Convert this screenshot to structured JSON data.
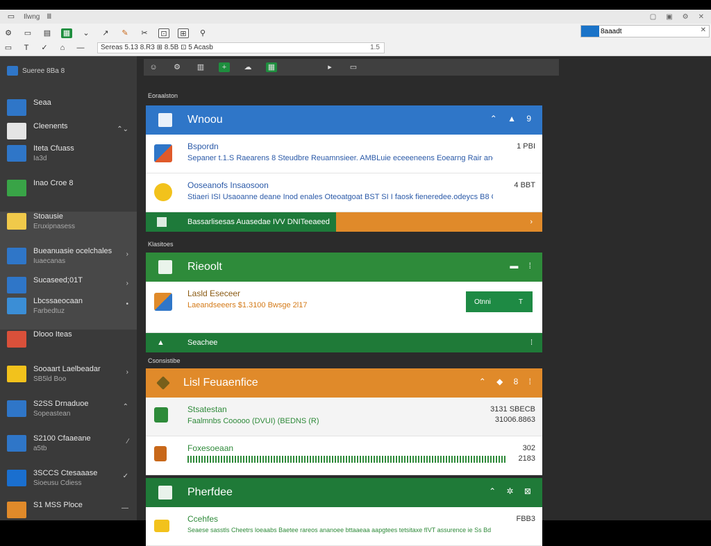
{
  "titlebar": {
    "app": "Ilwng",
    "tab": "Ⅲ"
  },
  "ribbon": {
    "address": "Sereas 5.13 8.R3 ⊞ 8.5B ⊡ 5 Acasb",
    "zoom": "1.5",
    "search_value": "8aaadt"
  },
  "sidebar": {
    "header": "Sueree 8Ba 8",
    "items": [
      {
        "t1": "Seaa",
        "t2": "",
        "chev": "",
        "color": "#2f76c8"
      },
      {
        "t1": "Cleenents",
        "t2": "",
        "chev": "⌃⌄",
        "color": "#e5e5e5"
      },
      {
        "t1": "Iteta Cfuass",
        "t2": "Ia3d",
        "chev": "",
        "color": "#2f76c8"
      },
      {
        "t1": "Inao Croe 8",
        "t2": "",
        "chev": "",
        "color": "#39a447"
      },
      {
        "t1": "Stoausie",
        "t2": "Eruxipnasess",
        "chev": "",
        "color": "#f0c94a"
      },
      {
        "t1": "Bueanuasie ocelchales",
        "t2": "Iuaecanas",
        "chev": "›",
        "color": "#2f76c8"
      },
      {
        "t1": "Sucaseed;01T",
        "t2": "",
        "chev": "›",
        "color": "#2f76c8"
      },
      {
        "t1": "Lbcssaeocaan",
        "t2": "Farbedtuz",
        "chev": "•",
        "color": "#3b8ed6"
      },
      {
        "t1": "Dlooo Iteas",
        "t2": "",
        "chev": "",
        "color": "#d9503a"
      },
      {
        "t1": "Sooaart Laelbeadar",
        "t2": "SB5ld Boo",
        "chev": "›",
        "color": "#f2c21c"
      },
      {
        "t1": "S2SS Drnaduoe",
        "t2": "Sopeastean",
        "chev": "⌃",
        "color": "#2f76c8"
      },
      {
        "t1": "S2100 Cfaaeane",
        "t2": "a5tb",
        "chev": "∕",
        "color": "#2f76c8"
      },
      {
        "t1": "3SCCS Ctesaaase",
        "t2": "Sioeusu Cdiess",
        "chev": "✓",
        "color": "#1a6fcf"
      },
      {
        "t1": "S1 MSS Ploce",
        "t2": "",
        "chev": "—",
        "color": "#e08a2a"
      }
    ]
  },
  "main": {
    "section1": "Eoraalston",
    "card1": {
      "title": "Wnoou",
      "hdr_right": "⌃ ▲ 9",
      "rows": [
        {
          "title": "Bspordn",
          "desc": "Sepaner t.1.S Raearens 8 Steudbre Reuamnsieer. AMBLuie eceeeneens Eoearng Rair aner B8.2BI5 BEB",
          "value": "1 PBI"
        },
        {
          "title": "Ooseanofs Insaosoon",
          "desc": "Stiaeri ISI Usaoanne deane Inod enales Oteoatgoat BST SI I faosk fieneredee.odeycs B8 OSO",
          "value": "4 BBT"
        }
      ],
      "foot": "Bassarlisesas Auasedae IVV DNITeeaeed",
      "foot_right": "›"
    },
    "section2": "Klasitoes",
    "card2": {
      "title": "Rieoolt",
      "hdr_right": "▬ ⁞",
      "row_title": "Lasld Eseceer",
      "row_desc": "Laeandseeers $1.3100 Bwsge 2l17",
      "btn_label": "Otnni",
      "btn_right": "T",
      "foot": "Seachee",
      "foot_right": "⁞"
    },
    "section3": "Csonsistibe",
    "card3": {
      "title": "Lisl Feuaenfice",
      "hdr_right": "⌃ ◆ 8 ⁞",
      "rows": [
        {
          "title": "Stsatestan",
          "desc": "Faalmnbs Cooooo (DVUI) (BEDNS (R)",
          "v1": "3131 SBECB",
          "v2": "31006.8863"
        },
        {
          "title": "Foxesoeaan",
          "desc": "",
          "v1": "302",
          "v2": "2183"
        }
      ]
    },
    "card4": {
      "title": "Pherfdee",
      "hdr_right": "⌃ ✲ ⊠",
      "row_title": "Ccehfes",
      "row_desc": "Seaese sasstls Cheetrs loeaabs Baetee rareos ananoee bttaaeaa aapgtees tetsitaxe fIVT assurence ie Ss Bd Bamo",
      "row_value": "FBB3"
    }
  },
  "colors": {
    "blue": "#2f76c8",
    "green": "#2e8b3a",
    "orange": "#e08a2a",
    "accentbar": "#1e8a44"
  }
}
